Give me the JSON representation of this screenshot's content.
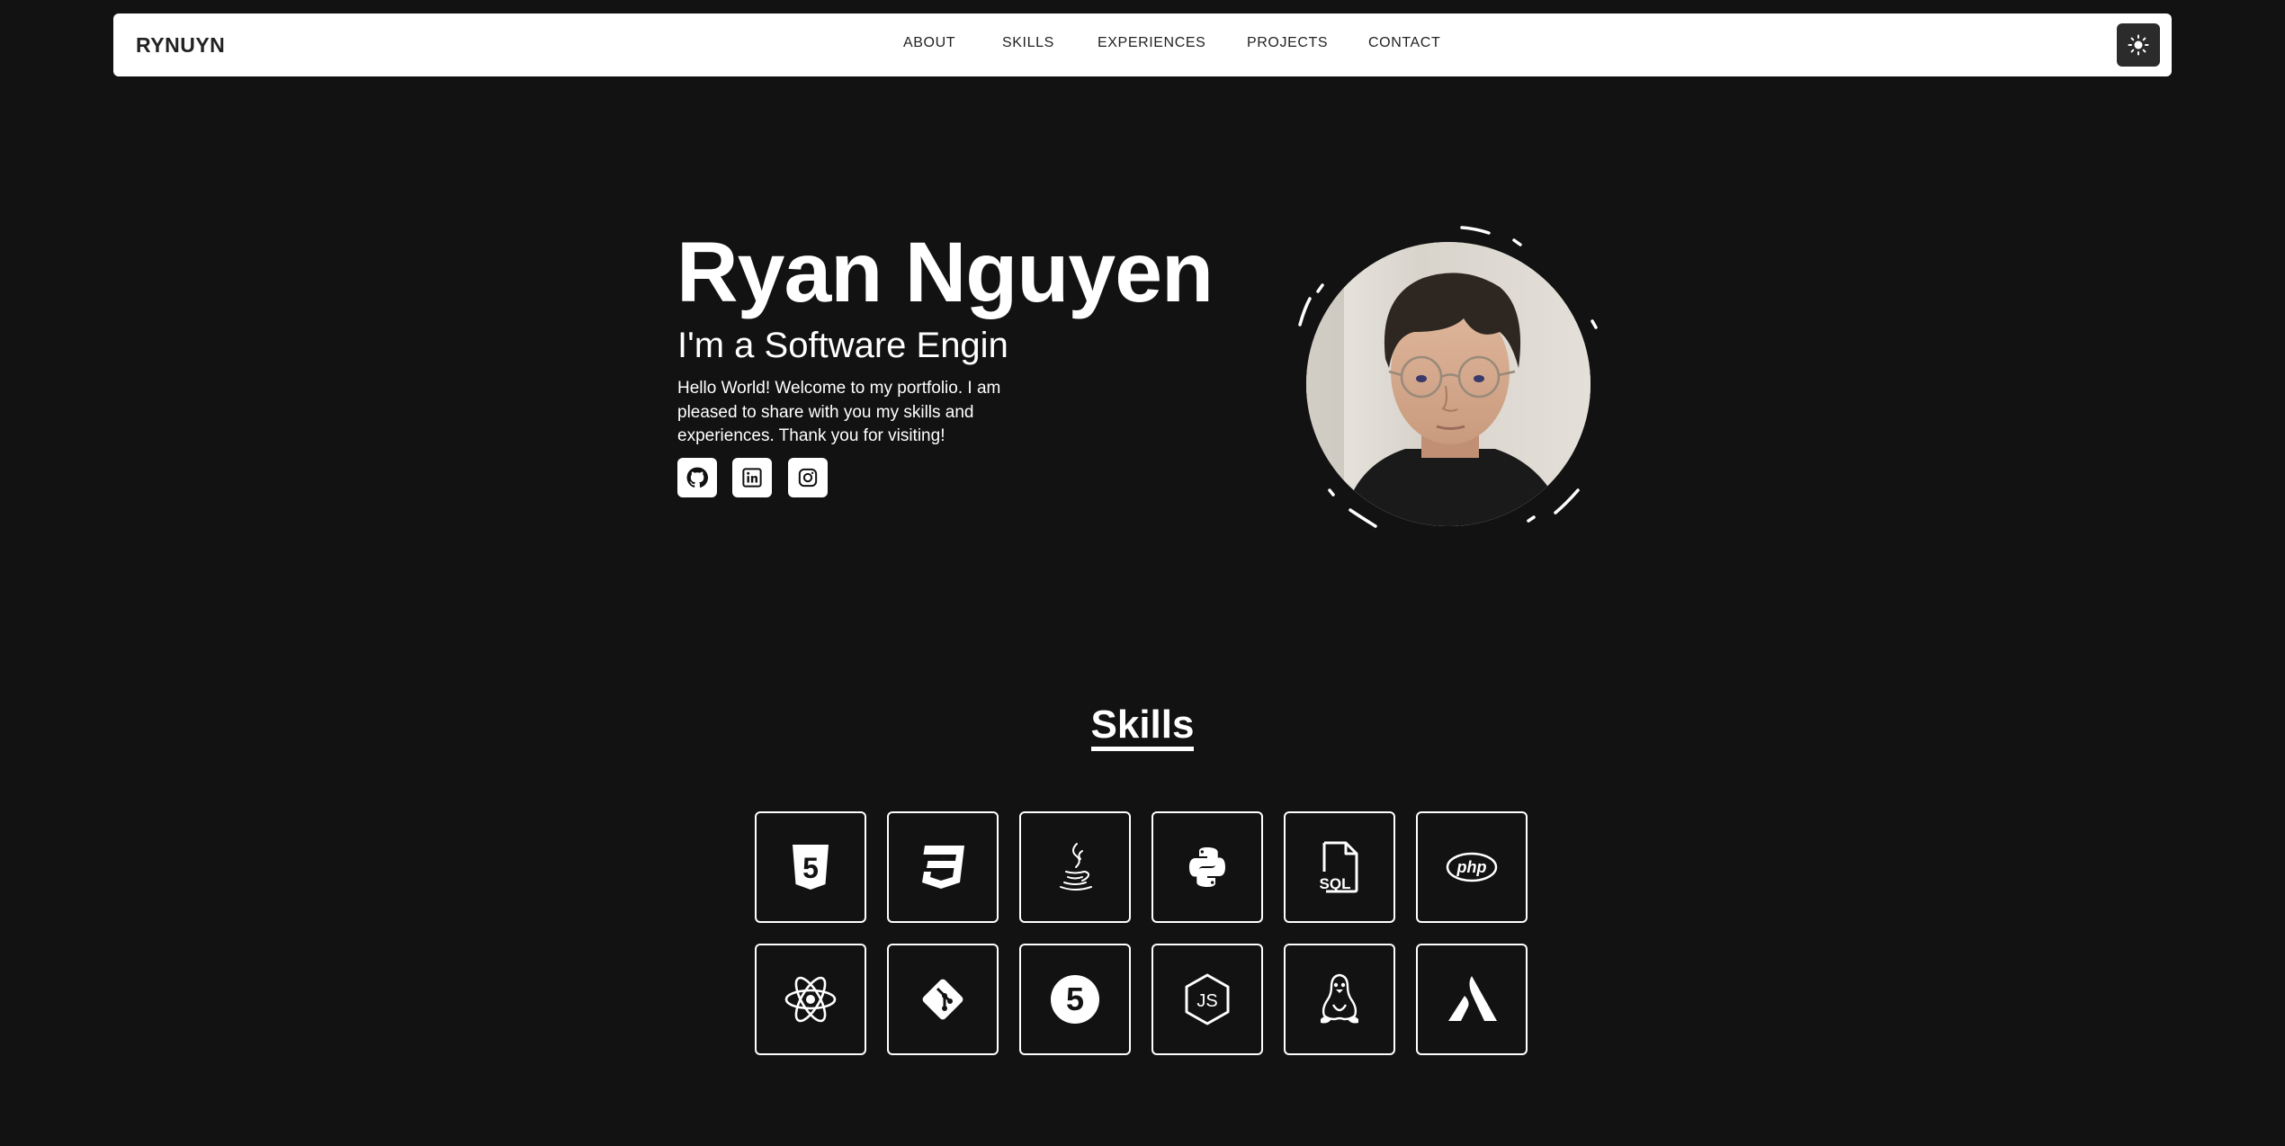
{
  "nav": {
    "brand": "RYNUYN",
    "links": [
      {
        "label": "ABOUT"
      },
      {
        "label": "SKILLS"
      },
      {
        "label": "EXPERIENCES"
      },
      {
        "label": "PROJECTS"
      },
      {
        "label": "CONTACT"
      }
    ],
    "theme_toggle_icon": "sun-icon"
  },
  "hero": {
    "name": "Ryan Nguyen",
    "role": "I'm a Software Engin",
    "intro": "Hello World! Welcome to my portfolio. I am pleased to share with you my skills and experiences. Thank you for visiting!",
    "socials": [
      {
        "icon": "github-icon"
      },
      {
        "icon": "linkedin-icon"
      },
      {
        "icon": "instagram-icon"
      }
    ],
    "avatar": "profile-photo"
  },
  "skills": {
    "title": "Skills",
    "items": [
      {
        "icon": "html5-icon",
        "tile_text": "5"
      },
      {
        "icon": "css3-icon",
        "tile_text": "3"
      },
      {
        "icon": "java-icon"
      },
      {
        "icon": "python-icon"
      },
      {
        "icon": "sql-icon",
        "tile_text": "SQL"
      },
      {
        "icon": "php-icon",
        "tile_text": "php"
      },
      {
        "icon": "react-icon"
      },
      {
        "icon": "git-icon"
      },
      {
        "icon": "nuxt-five-icon",
        "tile_text": "5"
      },
      {
        "icon": "nodejs-icon",
        "tile_text": "JS"
      },
      {
        "icon": "linux-icon"
      },
      {
        "icon": "atlassian-icon"
      }
    ]
  },
  "colors": {
    "background": "#121212",
    "navbar": "#ffffff",
    "text": "#ffffff",
    "nav_text": "#222222",
    "toggle_bg": "#2b2b2b"
  }
}
